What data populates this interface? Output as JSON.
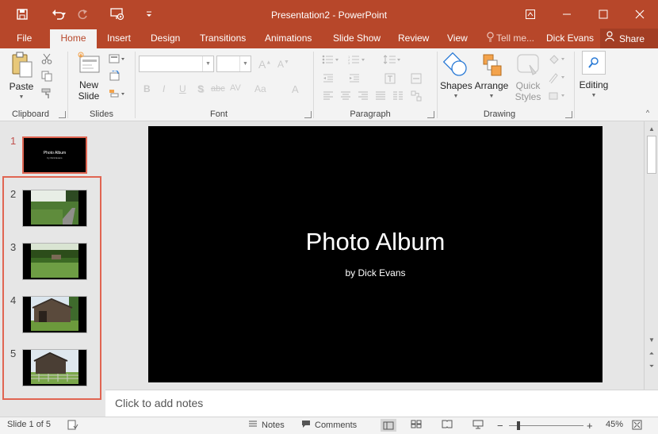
{
  "window": {
    "title": "Presentation2 - PowerPoint",
    "accent": "#b7472a"
  },
  "quick_access": [
    "save-icon",
    "undo-icon",
    "redo-icon",
    "present-from-start-icon",
    "customize-qat-icon"
  ],
  "tabs": [
    {
      "label": "File"
    },
    {
      "label": "Home"
    },
    {
      "label": "Insert"
    },
    {
      "label": "Design"
    },
    {
      "label": "Transitions"
    },
    {
      "label": "Animations"
    },
    {
      "label": "Slide Show"
    },
    {
      "label": "Review"
    },
    {
      "label": "View"
    }
  ],
  "tell_me": "Tell me...",
  "user": "Dick Evans",
  "share": "Share",
  "ribbon": {
    "clipboard": {
      "paste": "Paste",
      "group": "Clipboard"
    },
    "slides": {
      "new_slide_line1": "New",
      "new_slide_line2": "Slide",
      "group": "Slides"
    },
    "font": {
      "group": "Font",
      "bold": "B",
      "italic": "I",
      "underline": "U",
      "shadow": "S",
      "strike": "abc",
      "spacing": "AV",
      "case": "Aa",
      "clear": "A"
    },
    "paragraph": {
      "group": "Paragraph"
    },
    "drawing": {
      "shapes": "Shapes",
      "arrange": "Arrange",
      "quick_styles_line1": "Quick",
      "quick_styles_line2": "Styles",
      "group": "Drawing"
    },
    "editing": {
      "label": "Editing"
    }
  },
  "slides": [
    {
      "number": "1",
      "title": "Photo Album",
      "subtitle": "by Dick Evans",
      "selected": true
    },
    {
      "number": "2",
      "photo": "country-road-photo"
    },
    {
      "number": "3",
      "photo": "green-hillside-photo"
    },
    {
      "number": "4",
      "photo": "old-barn-photo"
    },
    {
      "number": "5",
      "photo": "barn-with-fence-photo"
    }
  ],
  "current_slide": {
    "title": "Photo Album",
    "subtitle": "by Dick Evans"
  },
  "notes_placeholder": "Click to add notes",
  "status": {
    "slide_info": "Slide 1 of 5",
    "notes": "Notes",
    "comments": "Comments",
    "zoom": "45%",
    "zoom_fraction": 0.45
  }
}
